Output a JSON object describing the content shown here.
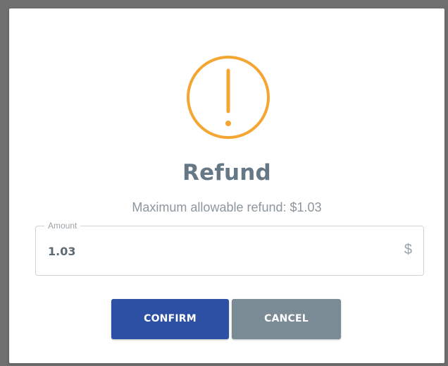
{
  "dialog": {
    "icon": "exclamation-circle-icon",
    "title": "Refund",
    "subtitle": "Maximum allowable refund: $1.03",
    "amount": {
      "label": "Amount",
      "value": "1.03",
      "currency_symbol": "$"
    },
    "buttons": {
      "confirm": "CONFIRM",
      "cancel": "CANCEL"
    }
  },
  "colors": {
    "warning": "#F4A532",
    "primary": "#2D4FA4",
    "secondary": "#7B8B95",
    "title": "#667886"
  }
}
